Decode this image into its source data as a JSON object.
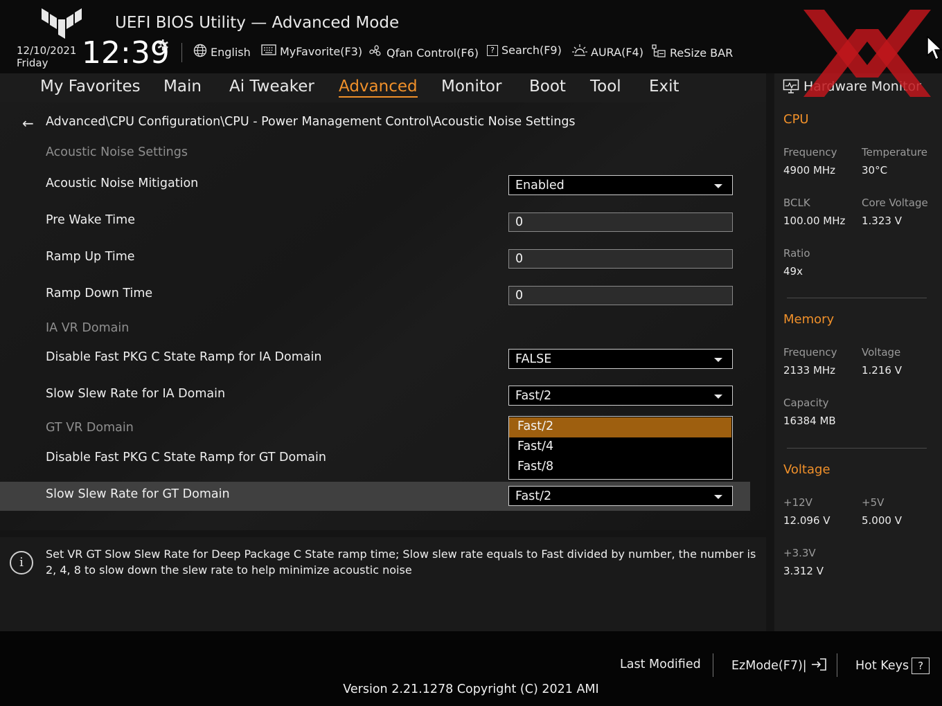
{
  "header": {
    "title": "UEFI BIOS Utility — Advanced Mode",
    "date": "12/10/2021",
    "weekday": "Friday",
    "time": "12:39",
    "tools": [
      {
        "icon": "globe-icon",
        "label": "English"
      },
      {
        "icon": "keyboard-icon",
        "label": "MyFavorite(F3)"
      },
      {
        "icon": "fan-icon",
        "label": "Qfan Control(F6)"
      },
      {
        "icon": "help-box-icon",
        "label": "Search(F9)"
      },
      {
        "icon": "light-icon",
        "label": "AURA(F4)"
      },
      {
        "icon": "resize-bar-icon",
        "label": "ReSize BAR"
      }
    ]
  },
  "tabs": [
    "My Favorites",
    "Main",
    "Ai Tweaker",
    "Advanced",
    "Monitor",
    "Boot",
    "Tool",
    "Exit"
  ],
  "active_tab": "Advanced",
  "breadcrumb": "Advanced\\CPU Configuration\\CPU - Power Management Control\\Acoustic Noise Settings",
  "settings": {
    "section_acoustic": "Acoustic Noise Settings",
    "acoustic_noise_mitigation": {
      "label": "Acoustic Noise Mitigation",
      "value": "Enabled"
    },
    "pre_wake_time": {
      "label": "Pre Wake Time",
      "value": "0"
    },
    "ramp_up_time": {
      "label": "Ramp Up Time",
      "value": "0"
    },
    "ramp_down_time": {
      "label": "Ramp Down Time",
      "value": "0"
    },
    "section_ia": "IA VR Domain",
    "disable_fast_pkg_ia": {
      "label": "Disable Fast PKG C State Ramp for IA Domain",
      "value": "FALSE"
    },
    "slow_slew_ia": {
      "label": "Slow Slew Rate for IA Domain",
      "value": "Fast/2"
    },
    "section_gt": "GT VR Domain",
    "disable_fast_pkg_gt": {
      "label": "Disable Fast PKG C State Ramp for GT Domain"
    },
    "slow_slew_gt": {
      "label": "Slow Slew Rate for GT Domain",
      "value": "Fast/2"
    }
  },
  "dropdown_options": [
    "Fast/2",
    "Fast/4",
    "Fast/8"
  ],
  "dropdown_selected": "Fast/2",
  "info_text": "Set VR GT Slow Slew Rate for Deep Package C State ramp time; Slow slew rate equals to Fast divided by number, the number is 2, 4, 8 to slow down the slew rate to help minimize acoustic noise",
  "hardware_monitor": {
    "title": "Hardware Monitor",
    "cpu": {
      "title": "CPU",
      "frequency_label": "Frequency",
      "frequency": "4900 MHz",
      "temperature_label": "Temperature",
      "temperature": "30°C",
      "bclk_label": "BCLK",
      "bclk": "100.00 MHz",
      "core_voltage_label": "Core Voltage",
      "core_voltage": "1.323 V",
      "ratio_label": "Ratio",
      "ratio": "49x"
    },
    "memory": {
      "title": "Memory",
      "frequency_label": "Frequency",
      "frequency": "2133 MHz",
      "voltage_label": "Voltage",
      "voltage": "1.216 V",
      "capacity_label": "Capacity",
      "capacity": "16384 MB"
    },
    "voltage": {
      "title": "Voltage",
      "v12_label": "+12V",
      "v12": "12.096 V",
      "v5_label": "+5V",
      "v5": "5.000 V",
      "v33_label": "+3.3V",
      "v33": "3.312 V"
    }
  },
  "footer": {
    "last_modified": "Last Modified",
    "ezmode": "EzMode(F7)|",
    "hot_keys": "Hot Keys",
    "version": "Version 2.21.1278 Copyright (C) 2021 AMI"
  },
  "colors": {
    "accent": "#f0902a",
    "selected_option": "#9e5f0f",
    "watermark": "#c0161c"
  }
}
